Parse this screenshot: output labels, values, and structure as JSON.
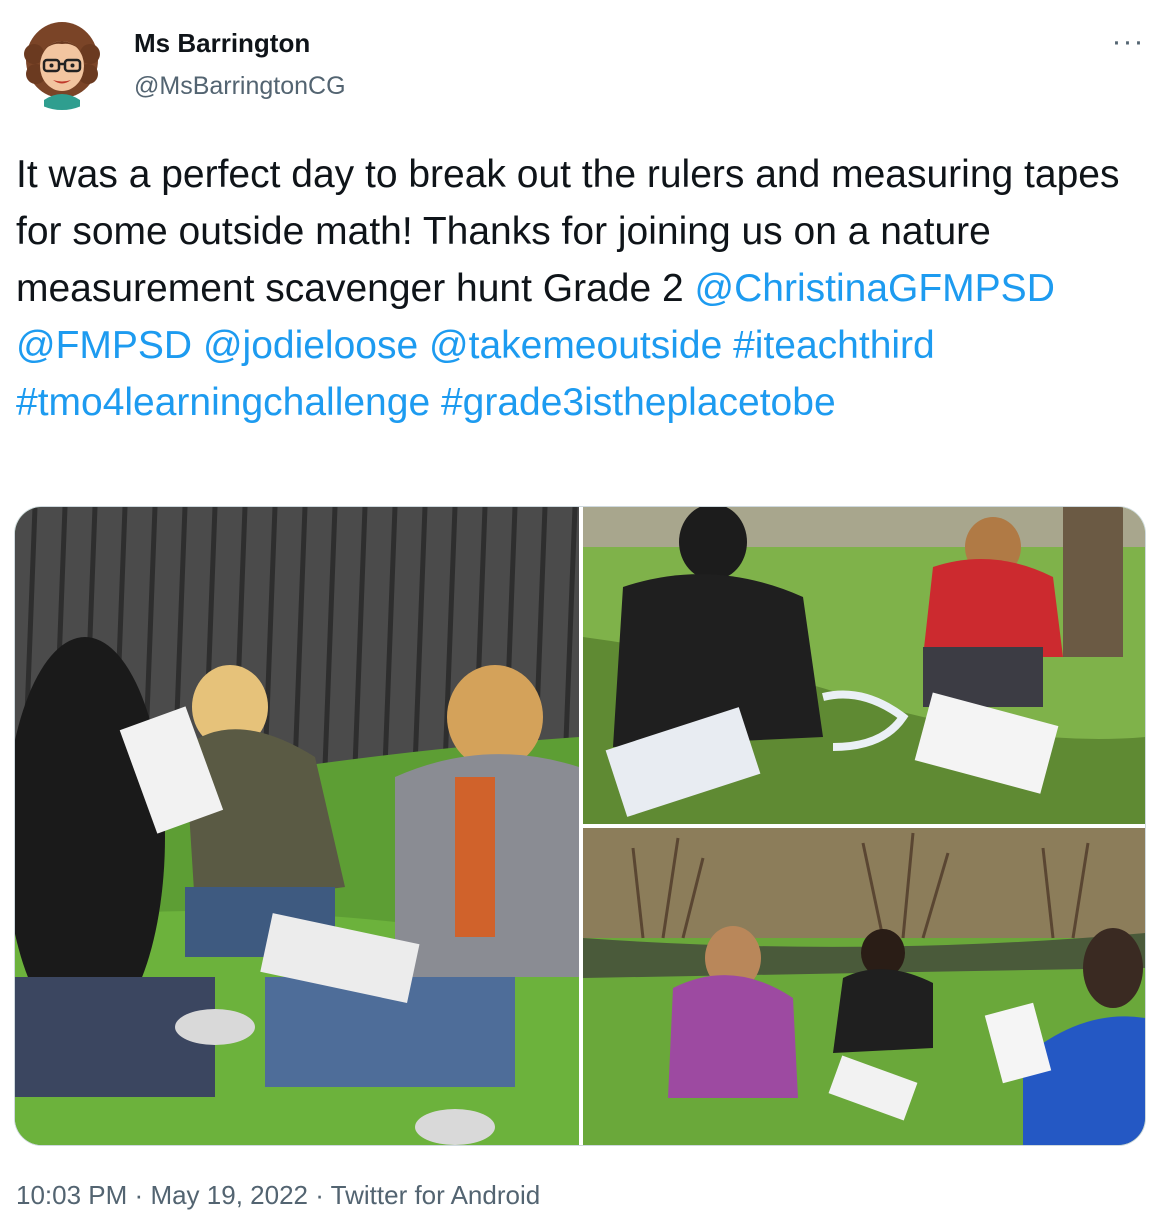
{
  "tweet": {
    "author": {
      "name": "Ms Barrington",
      "handle": "@MsBarringtonCG",
      "avatar_icon": "bitmoji-avatar"
    },
    "more_icon": "more-horizontal-icon",
    "more_glyph": "···",
    "text_parts": [
      {
        "type": "text",
        "value": "It was a perfect day to break out the rulers and measuring tapes for some outside math! Thanks for joining us on a nature measurement scavenger hunt Grade 2 "
      },
      {
        "type": "link",
        "value": "@ChristinaGFMPSD"
      },
      {
        "type": "text",
        "value": " "
      },
      {
        "type": "link",
        "value": "@FMPSD"
      },
      {
        "type": "text",
        "value": " "
      },
      {
        "type": "link",
        "value": "@jodieloose"
      },
      {
        "type": "text",
        "value": " "
      },
      {
        "type": "link",
        "value": "@takemeoutside"
      },
      {
        "type": "text",
        "value": " "
      },
      {
        "type": "link",
        "value": "#iteachthird"
      },
      {
        "type": "text",
        "value": " "
      },
      {
        "type": "link",
        "value": "#tmo4learningchallenge"
      },
      {
        "type": "text",
        "value": " "
      },
      {
        "type": "link",
        "value": "#grade3istheplacetobe"
      }
    ],
    "photo_count": 3,
    "time": "10:03 PM",
    "separator": "·",
    "date": "May 19, 2022",
    "source": "Twitter for Android",
    "colors": {
      "link": "#1d9bf0",
      "secondary_text": "#536471",
      "text": "#0f1419",
      "border": "#cfd9de"
    }
  }
}
